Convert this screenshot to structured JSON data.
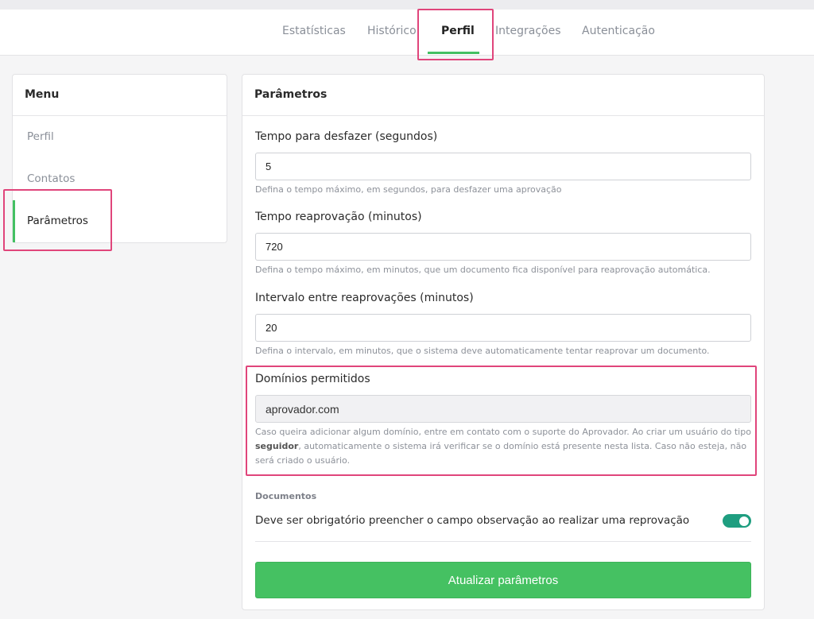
{
  "nav": {
    "tabs": [
      {
        "label": "Estatísticas"
      },
      {
        "label": "Histórico"
      },
      {
        "label": "Perfil",
        "active": true
      },
      {
        "label": "Integrações"
      },
      {
        "label": "Autenticação"
      }
    ]
  },
  "menu": {
    "title": "Menu",
    "items": [
      {
        "label": "Perfil"
      },
      {
        "label": "Contatos"
      },
      {
        "label": "Parâmetros",
        "active": true
      }
    ]
  },
  "params": {
    "title": "Parâmetros",
    "undo": {
      "label": "Tempo para desfazer (segundos)",
      "value": "5",
      "help": "Defina o tempo máximo, em segundos, para desfazer uma aprovação"
    },
    "reapproval": {
      "label": "Tempo reaprovação (minutos)",
      "value": "720",
      "help": "Defina o tempo máximo, em minutos, que um documento fica disponível para reaprovação automática."
    },
    "interval": {
      "label": "Intervalo entre reaprovações (minutos)",
      "value": "20",
      "help": "Defina o intervalo, em minutos, que o sistema deve automaticamente tentar reaprovar um documento."
    },
    "domains": {
      "label": "Domínios permitidos",
      "value": "aprovador.com",
      "help_part1": "Caso queira adicionar algum domínio, entre em contato com o suporte do Aprovador. Ao criar um usuário do tipo ",
      "help_bold": "seguidor",
      "help_part2": ", automaticamente o sistema irá verificar se o domínio está presente nesta lista. Caso não esteja, não será criado o usuário."
    },
    "documents": {
      "section": "Documentos",
      "toggle_label": "Deve ser obrigatório preencher o campo observação ao realizar uma reprovação",
      "toggle_on": true
    },
    "submit_label": "Atualizar parâmetros"
  },
  "colors": {
    "accent_green": "#44c062",
    "toggle_on": "#1f9e80",
    "highlight": "#e0457b"
  }
}
